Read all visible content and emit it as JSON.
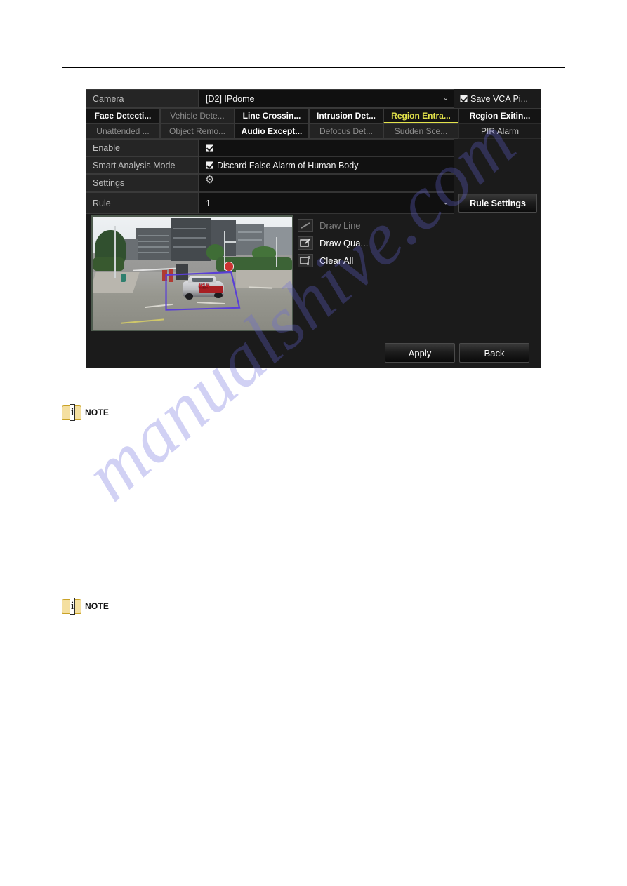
{
  "watermark": {
    "text": "manualshive.com"
  },
  "dialog": {
    "camera": {
      "label": "Camera",
      "value": "[D2] IPdome",
      "dropdown_glyph": "⌄"
    },
    "save_vca": {
      "label": "Save VCA Pi...",
      "checked": true
    },
    "tabs": [
      {
        "label": "Face Detecti...",
        "state": "enabled"
      },
      {
        "label": "Vehicle Dete...",
        "state": "disabled"
      },
      {
        "label": "Line Crossin...",
        "state": "enabled"
      },
      {
        "label": "Intrusion Det...",
        "state": "enabled"
      },
      {
        "label": "Region Entra...",
        "state": "active"
      },
      {
        "label": "Region Exitin...",
        "state": "enabled"
      },
      {
        "label": "Unattended ...",
        "state": "disabled"
      },
      {
        "label": "Object Remo...",
        "state": "disabled"
      },
      {
        "label": "Audio Except...",
        "state": "enabled"
      },
      {
        "label": "Defocus Det...",
        "state": "disabled"
      },
      {
        "label": "Sudden Sce...",
        "state": "disabled"
      },
      {
        "label": "PIR Alarm",
        "state": "plain"
      }
    ],
    "rows": {
      "enable": {
        "label": "Enable",
        "checked": true
      },
      "smart_analysis_mode": {
        "label": "Smart Analysis Mode",
        "checked": true,
        "option": "Discard False Alarm of Human Body"
      },
      "settings": {
        "label": "Settings",
        "icon": "gear-icon"
      },
      "rule": {
        "label": "Rule",
        "value": "1",
        "dropdown_glyph": "⌄",
        "button": "Rule Settings"
      }
    },
    "tools": [
      {
        "label": "Draw Line",
        "icon": "draw-line-icon",
        "state": "disabled"
      },
      {
        "label": "Draw Qua...",
        "icon": "draw-quad-icon",
        "state": "enabled"
      },
      {
        "label": "Clear All",
        "icon": "clear-all-icon",
        "state": "enabled"
      }
    ],
    "preview": {
      "region_label": "#1#",
      "region_color": "#5a3fd6"
    },
    "footer": {
      "apply": "Apply",
      "back": "Back"
    }
  },
  "notes": [
    {
      "text": "NOTE",
      "icon": "note-info-icon"
    },
    {
      "text": "NOTE",
      "icon": "note-info-icon"
    }
  ],
  "colors": {
    "accent_yellow": "#e3e34a",
    "panel_bg": "#1b1b1b",
    "region_blue": "#5a3fd6",
    "label_red": "#d8202a"
  }
}
